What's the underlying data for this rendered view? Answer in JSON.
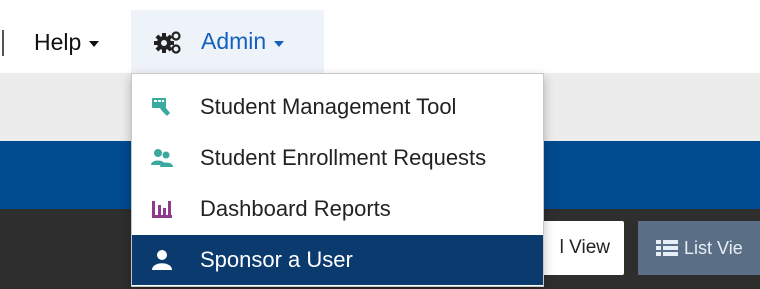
{
  "nav": {
    "help_label": "Help",
    "admin_label": "Admin",
    "admin_icon": "gears-icon",
    "accent_color": "#1560bd"
  },
  "admin_menu": {
    "items": [
      {
        "label": "Student Management Tool",
        "icon": "student-management-icon",
        "icon_color": "#3aa99f"
      },
      {
        "label": "Student Enrollment Requests",
        "icon": "users-group-icon",
        "icon_color": "#3aa99f"
      },
      {
        "label": "Dashboard Reports",
        "icon": "bar-chart-icon",
        "icon_color": "#8e3b8e"
      },
      {
        "label": "Sponsor a User",
        "icon": "user-icon",
        "icon_color": "#ffffff",
        "active": true
      }
    ],
    "active_bg": "#0b3b6e"
  },
  "toolbar": {
    "view_label": "l View",
    "list_view_label": "List Vie"
  },
  "colors": {
    "header_blue": "#004a8f",
    "dark_bar": "#2e2e2e",
    "grey_bar": "#ececec"
  }
}
